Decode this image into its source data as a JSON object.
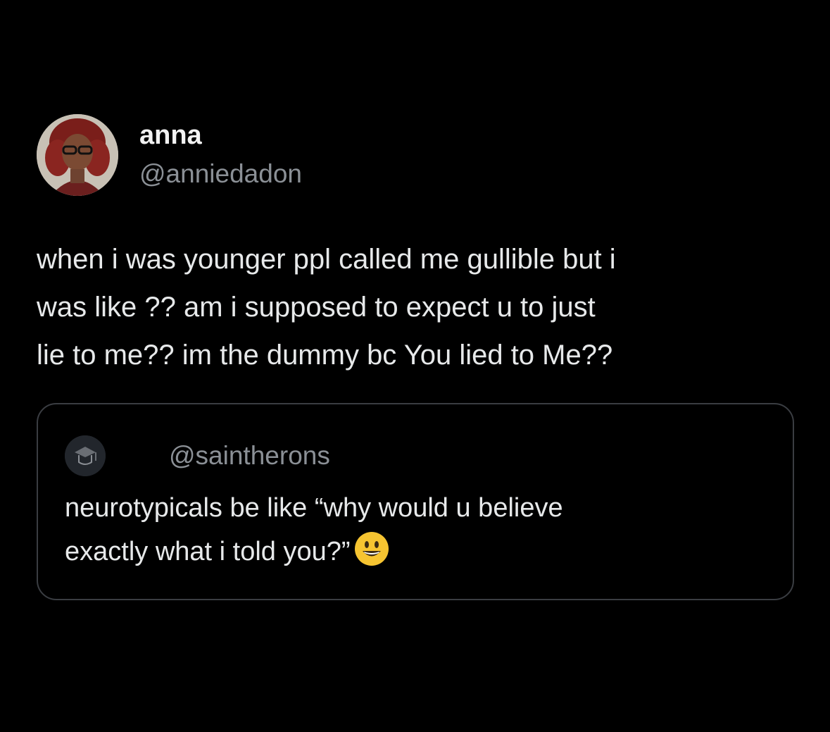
{
  "tweet": {
    "display_name": "anna",
    "handle": "@anniedadon",
    "text_lines": [
      "when i was younger ppl called me gullible but i",
      "was like ?? am i supposed to expect u to just",
      "lie to me?? im the dummy bc You lied to Me??"
    ],
    "avatar_icon": "profile-photo"
  },
  "quoted": {
    "handle": "@saintherons",
    "name_icon": "crescent-moon-icon",
    "text_lines": [
      "neurotypicals be like “why would u believe",
      "exactly what i told you?”"
    ],
    "emoji": "grinning-face-icon"
  },
  "colors": {
    "background": "#000000",
    "primary_text": "#e7e9ea",
    "secondary_text": "#8b9096",
    "border": "#3a3d42",
    "moon": "#f5c542",
    "emoji": "#f6c431"
  }
}
